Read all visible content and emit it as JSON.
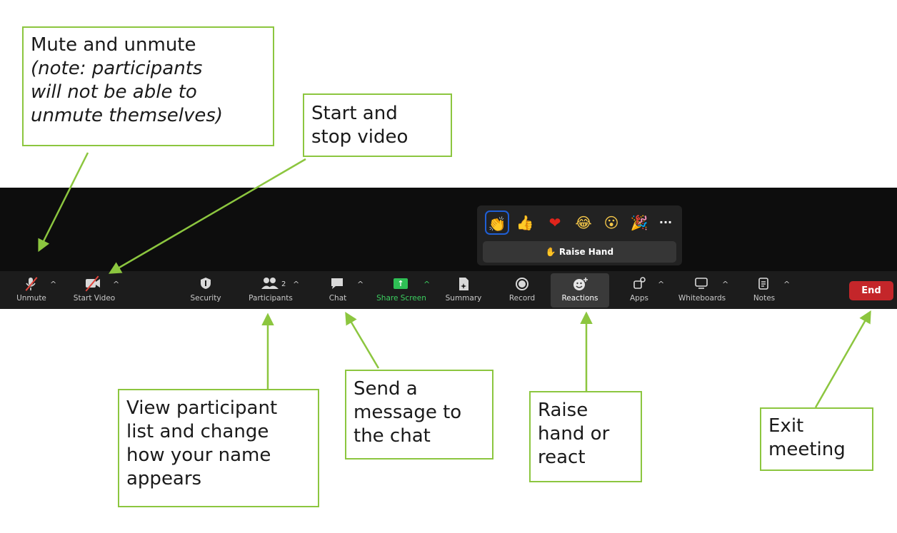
{
  "callouts": {
    "mute": {
      "line1": "Mute and unmute",
      "line2": "(note: participants",
      "line3": "will not be able to",
      "line4": "unmute themselves)"
    },
    "video": {
      "line1": "Start and",
      "line2": "stop video"
    },
    "participants": {
      "line1": "View participant",
      "line2": "list and change",
      "line3": "how your name",
      "line4": "appears"
    },
    "chat": {
      "line1": "Send a",
      "line2": "message to",
      "line3": "the chat"
    },
    "reactions": {
      "line1": "Raise",
      "line2": "hand or",
      "line3": "react"
    },
    "exit": {
      "line1": "Exit",
      "line2": "meeting"
    }
  },
  "reactions_popup": {
    "emojis": [
      {
        "icon": "clapping-hands-icon",
        "glyph": "👏"
      },
      {
        "icon": "thumbs-up-icon",
        "glyph": "👍"
      },
      {
        "icon": "red-heart-icon",
        "glyph": "❤"
      },
      {
        "icon": "tears-of-joy-icon",
        "glyph": "😂"
      },
      {
        "icon": "open-mouth-icon",
        "glyph": "😮"
      },
      {
        "icon": "party-popper-icon",
        "glyph": "🎉"
      },
      {
        "icon": "more-icon",
        "glyph": "···"
      }
    ],
    "raise_hand_label": "Raise Hand",
    "raise_hand_glyph": "✋"
  },
  "toolbar": {
    "unmute_label": "Unmute",
    "start_video_label": "Start Video",
    "security_label": "Security",
    "participants_label": "Participants",
    "participants_count": "2",
    "chat_label": "Chat",
    "share_screen_label": "Share Screen",
    "summary_label": "Summary",
    "record_label": "Record",
    "reactions_label": "Reactions",
    "apps_label": "Apps",
    "whiteboards_label": "Whiteboards",
    "notes_label": "Notes",
    "end_label": "End",
    "caret_glyph": "^"
  },
  "colors": {
    "callout_border": "#8cc63f",
    "toolbar_bg": "#1c1c1c",
    "share_screen_green": "#2fbf55",
    "end_red": "#c4262a",
    "selected_emoji_border": "#1f5fd6"
  }
}
